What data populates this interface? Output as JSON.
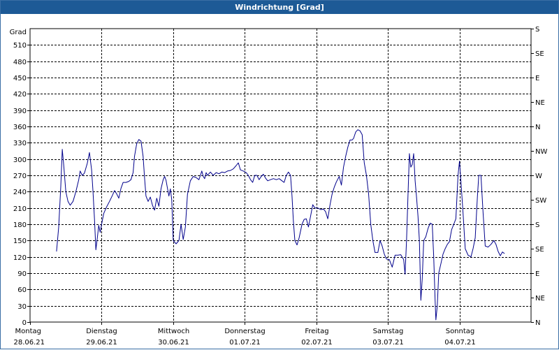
{
  "window": {
    "title": "Windrichtung [Grad]"
  },
  "chart_data": {
    "type": "line",
    "title": "Windrichtung [Grad]",
    "ylabel": "Grad",
    "ylim": [
      0,
      540
    ],
    "grid": true,
    "y_ticks": [
      0,
      30,
      60,
      90,
      120,
      150,
      180,
      210,
      240,
      270,
      300,
      330,
      360,
      390,
      420,
      450,
      480,
      510
    ],
    "y_right_ticks": [
      {
        "value": 0,
        "label": "N"
      },
      {
        "value": 45,
        "label": "NE"
      },
      {
        "value": 90,
        "label": "E"
      },
      {
        "value": 135,
        "label": "SE"
      },
      {
        "value": 180,
        "label": "S"
      },
      {
        "value": 225,
        "label": "SW"
      },
      {
        "value": 270,
        "label": "W"
      },
      {
        "value": 315,
        "label": "NW"
      },
      {
        "value": 360,
        "label": "N"
      },
      {
        "value": 405,
        "label": "NE"
      },
      {
        "value": 450,
        "label": "E"
      },
      {
        "value": 495,
        "label": "SE"
      },
      {
        "value": 540,
        "label": "S"
      }
    ],
    "x_ticks": [
      {
        "day": "Montag",
        "date": "28.06.21"
      },
      {
        "day": "Dienstag",
        "date": "29.06.21"
      },
      {
        "day": "Mittwoch",
        "date": "30.06.21"
      },
      {
        "day": "Donnerstag",
        "date": "01.07.21"
      },
      {
        "day": "Freitag",
        "date": "02.07.21"
      },
      {
        "day": "Samstag",
        "date": "03.07.21"
      },
      {
        "day": "Sonntag",
        "date": "04.07.21"
      }
    ],
    "xlim_days": [
      0,
      7
    ],
    "series": [
      {
        "color": "#00008b",
        "points": [
          [
            0.37,
            130
          ],
          [
            0.4,
            175
          ],
          [
            0.43,
            250
          ],
          [
            0.45,
            318
          ],
          [
            0.47,
            290
          ],
          [
            0.5,
            240
          ],
          [
            0.53,
            222
          ],
          [
            0.56,
            215
          ],
          [
            0.6,
            222
          ],
          [
            0.64,
            240
          ],
          [
            0.68,
            262
          ],
          [
            0.7,
            278
          ],
          [
            0.73,
            270
          ],
          [
            0.76,
            274
          ],
          [
            0.8,
            292
          ],
          [
            0.83,
            312
          ],
          [
            0.86,
            280
          ],
          [
            0.88,
            240
          ],
          [
            0.9,
            190
          ],
          [
            0.92,
            133
          ],
          [
            0.94,
            155
          ],
          [
            0.96,
            178
          ],
          [
            0.98,
            165
          ],
          [
            1.0,
            180
          ],
          [
            1.03,
            200
          ],
          [
            1.07,
            212
          ],
          [
            1.11,
            222
          ],
          [
            1.15,
            233
          ],
          [
            1.18,
            242
          ],
          [
            1.21,
            236
          ],
          [
            1.24,
            228
          ],
          [
            1.27,
            246
          ],
          [
            1.3,
            257
          ],
          [
            1.34,
            257
          ],
          [
            1.38,
            259
          ],
          [
            1.41,
            262
          ],
          [
            1.44,
            275
          ],
          [
            1.46,
            305
          ],
          [
            1.49,
            328
          ],
          [
            1.52,
            336
          ],
          [
            1.55,
            333
          ],
          [
            1.58,
            305
          ],
          [
            1.6,
            265
          ],
          [
            1.62,
            232
          ],
          [
            1.65,
            222
          ],
          [
            1.68,
            230
          ],
          [
            1.71,
            215
          ],
          [
            1.74,
            206
          ],
          [
            1.77,
            228
          ],
          [
            1.8,
            213
          ],
          [
            1.83,
            245
          ],
          [
            1.86,
            262
          ],
          [
            1.88,
            268
          ],
          [
            1.9,
            261
          ],
          [
            1.92,
            246
          ],
          [
            1.94,
            232
          ],
          [
            1.96,
            245
          ],
          [
            1.98,
            225
          ],
          [
            2.0,
            150
          ],
          [
            2.04,
            144
          ],
          [
            2.08,
            150
          ],
          [
            2.11,
            180
          ],
          [
            2.14,
            152
          ],
          [
            2.17,
            175
          ],
          [
            2.2,
            235
          ],
          [
            2.24,
            260
          ],
          [
            2.28,
            268
          ],
          [
            2.32,
            266
          ],
          [
            2.36,
            262
          ],
          [
            2.38,
            270
          ],
          [
            2.4,
            278
          ],
          [
            2.42,
            268
          ],
          [
            2.44,
            264
          ],
          [
            2.46,
            275
          ],
          [
            2.48,
            270
          ],
          [
            2.52,
            276
          ],
          [
            2.56,
            270
          ],
          [
            2.6,
            275
          ],
          [
            2.64,
            273
          ],
          [
            2.68,
            276
          ],
          [
            2.72,
            275
          ],
          [
            2.76,
            278
          ],
          [
            2.8,
            279
          ],
          [
            2.84,
            282
          ],
          [
            2.88,
            288
          ],
          [
            2.91,
            293
          ],
          [
            2.94,
            280
          ],
          [
            2.98,
            278
          ],
          [
            3.02,
            275
          ],
          [
            3.05,
            270
          ],
          [
            3.08,
            262
          ],
          [
            3.11,
            257
          ],
          [
            3.14,
            270
          ],
          [
            3.17,
            270
          ],
          [
            3.2,
            262
          ],
          [
            3.23,
            268
          ],
          [
            3.26,
            272
          ],
          [
            3.29,
            265
          ],
          [
            3.32,
            260
          ],
          [
            3.36,
            262
          ],
          [
            3.4,
            264
          ],
          [
            3.44,
            262
          ],
          [
            3.48,
            264
          ],
          [
            3.52,
            260
          ],
          [
            3.55,
            257
          ],
          [
            3.58,
            270
          ],
          [
            3.61,
            276
          ],
          [
            3.64,
            270
          ],
          [
            3.66,
            232
          ],
          [
            3.68,
            185
          ],
          [
            3.7,
            150
          ],
          [
            3.73,
            142
          ],
          [
            3.76,
            155
          ],
          [
            3.8,
            180
          ],
          [
            3.83,
            189
          ],
          [
            3.86,
            190
          ],
          [
            3.89,
            175
          ],
          [
            3.92,
            195
          ],
          [
            3.95,
            216
          ],
          [
            3.98,
            210
          ],
          [
            4.02,
            210
          ],
          [
            4.06,
            207
          ],
          [
            4.1,
            208
          ],
          [
            4.13,
            203
          ],
          [
            4.16,
            190
          ],
          [
            4.19,
            215
          ],
          [
            4.22,
            235
          ],
          [
            4.25,
            248
          ],
          [
            4.28,
            258
          ],
          [
            4.32,
            268
          ],
          [
            4.35,
            252
          ],
          [
            4.38,
            285
          ],
          [
            4.41,
            305
          ],
          [
            4.44,
            322
          ],
          [
            4.47,
            335
          ],
          [
            4.5,
            335
          ],
          [
            4.52,
            338
          ],
          [
            4.55,
            350
          ],
          [
            4.58,
            354
          ],
          [
            4.61,
            352
          ],
          [
            4.64,
            345
          ],
          [
            4.67,
            293
          ],
          [
            4.7,
            270
          ],
          [
            4.73,
            236
          ],
          [
            4.76,
            180
          ],
          [
            4.79,
            150
          ],
          [
            4.82,
            128
          ],
          [
            4.86,
            128
          ],
          [
            4.89,
            150
          ],
          [
            4.92,
            140
          ],
          [
            4.95,
            125
          ],
          [
            4.98,
            116
          ],
          [
            5.02,
            115
          ],
          [
            5.06,
            101
          ],
          [
            5.1,
            123
          ],
          [
            5.14,
            123
          ],
          [
            5.18,
            124
          ],
          [
            5.22,
            115
          ],
          [
            5.24,
            88
          ],
          [
            5.26,
            150
          ],
          [
            5.28,
            230
          ],
          [
            5.3,
            310
          ],
          [
            5.32,
            285
          ],
          [
            5.34,
            290
          ],
          [
            5.36,
            310
          ],
          [
            5.38,
            260
          ],
          [
            5.4,
            230
          ],
          [
            5.42,
            195
          ],
          [
            5.44,
            150
          ],
          [
            5.46,
            40
          ],
          [
            5.48,
            80
          ],
          [
            5.5,
            150
          ],
          [
            5.53,
            157
          ],
          [
            5.56,
            172
          ],
          [
            5.59,
            182
          ],
          [
            5.62,
            180
          ],
          [
            5.64,
            120
          ],
          [
            5.66,
            40
          ],
          [
            5.67,
            4
          ],
          [
            5.69,
            30
          ],
          [
            5.71,
            90
          ],
          [
            5.74,
            107
          ],
          [
            5.77,
            125
          ],
          [
            5.8,
            135
          ],
          [
            5.83,
            143
          ],
          [
            5.86,
            148
          ],
          [
            5.89,
            170
          ],
          [
            5.92,
            180
          ],
          [
            5.95,
            190
          ],
          [
            5.98,
            270
          ],
          [
            6.0,
            296
          ],
          [
            6.02,
            260
          ],
          [
            6.05,
            200
          ],
          [
            6.08,
            135
          ],
          [
            6.12,
            123
          ],
          [
            6.16,
            120
          ],
          [
            6.19,
            135
          ],
          [
            6.22,
            155
          ],
          [
            6.25,
            230
          ],
          [
            6.27,
            270
          ],
          [
            6.3,
            270
          ],
          [
            6.33,
            200
          ],
          [
            6.36,
            140
          ],
          [
            6.4,
            138
          ],
          [
            6.44,
            143
          ],
          [
            6.48,
            150
          ],
          [
            6.51,
            143
          ],
          [
            6.54,
            130
          ],
          [
            6.57,
            122
          ],
          [
            6.6,
            129
          ],
          [
            6.63,
            126
          ]
        ]
      }
    ]
  }
}
